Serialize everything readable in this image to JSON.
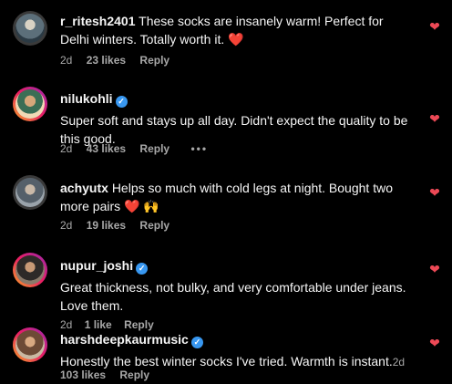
{
  "comments": [
    {
      "username": "r_ritesh2401",
      "text": "These socks are insanely warm! Perfect for Delhi winters. Totally worth it.",
      "emoji": "❤️",
      "time": "2d",
      "likes": "23 likes",
      "reply": "Reply",
      "verified": false
    },
    {
      "username": "nilukohli",
      "text": "Super soft and stays up all day. Didn't expect the quality to be this good.",
      "time": "2d",
      "likes": "43 likes",
      "reply": "Reply",
      "more": "•••",
      "verified": true
    },
    {
      "username": "achyutx",
      "text": "Helps so much with cold legs at night. Bought two more pairs",
      "emoji": "❤️ 🙌",
      "time": "2d",
      "likes": "19 likes",
      "reply": "Reply",
      "verified": false
    },
    {
      "username": "nupur_joshi",
      "text": "Great thickness, not bulky, and very comfortable under jeans. Love them.",
      "time": "2d",
      "likes": "1 like",
      "reply": "Reply",
      "verified": true
    },
    {
      "username": "harshdeepkaurmusic",
      "text": "Honestly the best winter socks I've tried. Warmth is instant.",
      "time": "2d",
      "likes": "103 likes",
      "reply": "Reply",
      "verified": true
    }
  ],
  "icons": {
    "like": "heart-icon",
    "verified": "verified-badge-icon"
  },
  "colors": {
    "background": "#000000",
    "text": "#f5f5f5",
    "meta": "#a8a8a8",
    "heart": "#ed4956",
    "verified": "#3897f0"
  }
}
